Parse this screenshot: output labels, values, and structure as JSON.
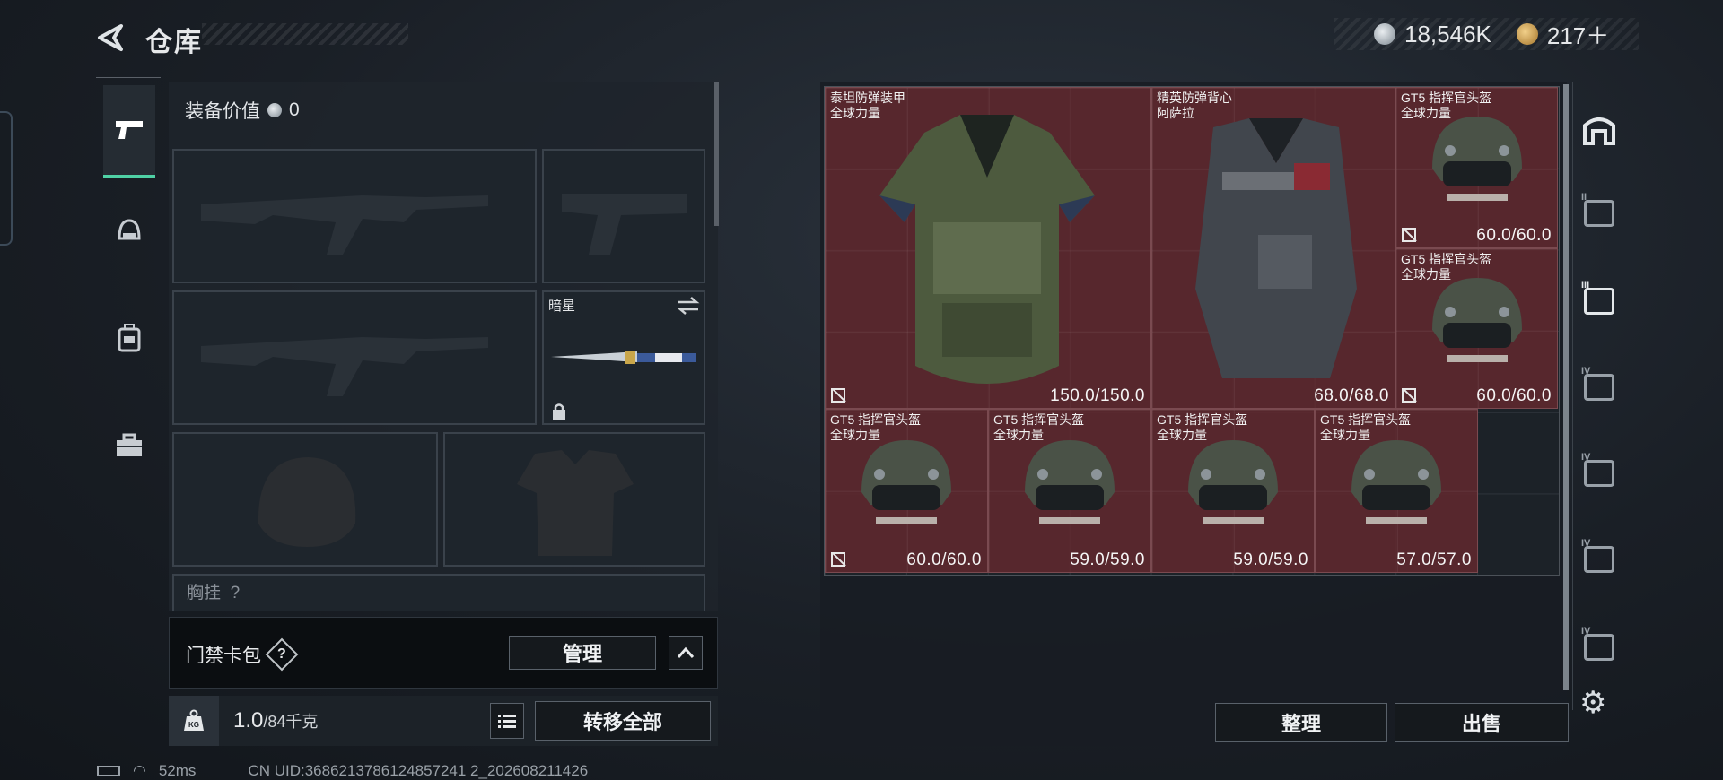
{
  "header": {
    "title": "仓库",
    "silver": "18,546K",
    "gold": "217＋"
  },
  "loadout": {
    "gear_value_label": "装备价值",
    "gear_value": "0",
    "melee_name": "暗星",
    "chest_label_partial": "胸挂",
    "chest_value_partial": "?"
  },
  "cardbar": {
    "label": "门禁卡包",
    "help": "?",
    "manage": "管理"
  },
  "weight": {
    "current": "1.0",
    "max": "/84千克",
    "transfer": "转移全部"
  },
  "status": {
    "ping": "52ms",
    "uid": "CN UID:3686213786124857241 2_202608211426"
  },
  "storage": {
    "items": [
      {
        "name": "泰坦防弹装甲\n全球力量",
        "durability": "150.0/150.0"
      },
      {
        "name": "精英防弹背心\n阿萨拉",
        "durability": "68.0/68.0"
      },
      {
        "name": "GT5 指挥官头盔\n全球力量",
        "durability": "60.0/60.0"
      },
      {
        "name": "GT5 指挥官头盔\n全球力量",
        "durability": "60.0/60.0"
      },
      {
        "name": "GT5 指挥官头盔\n全球力量",
        "durability": "60.0/60.0"
      },
      {
        "name": "GT5 指挥官头盔\n全球力量",
        "durability": "59.0/59.0"
      },
      {
        "name": "GT5 指挥官头盔\n全球力量",
        "durability": "59.0/59.0"
      },
      {
        "name": "GT5 指挥官头盔\n全球力量",
        "durability": "57.0/57.0"
      }
    ],
    "sort": "整理",
    "sell": "出售"
  },
  "right_tabs": [
    "II",
    "III",
    "IV",
    "IV",
    "IV",
    "IV"
  ],
  "icons": [
    "back-arrow-icon",
    "silver-coin-icon",
    "gold-coin-icon",
    "pistol-icon",
    "helmet-icon",
    "backpack-icon",
    "toolbox-icon",
    "swap-icon",
    "lock-icon",
    "list-icon",
    "kg-weight-icon",
    "settings-gear-icon"
  ]
}
